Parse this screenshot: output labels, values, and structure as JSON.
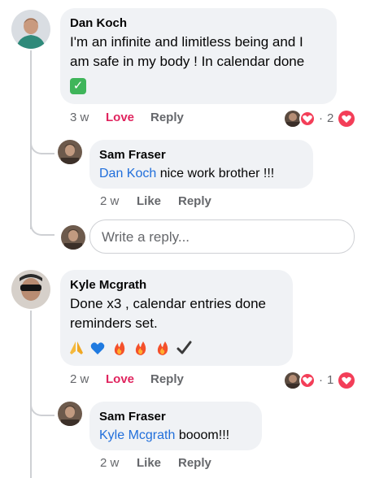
{
  "comments": [
    {
      "author": "Dan Koch",
      "text": "I'm an infinite and limitless being and I am safe in my body ! In  calendar done",
      "line1": "I'm an infinite and limitless being and I",
      "line2": "am safe in my body ! In  calendar done",
      "emoji_line": "✅",
      "time": "3 w",
      "love_label": "Love",
      "reply_label": "Reply",
      "reaction_count": "2",
      "reply": {
        "author": "Sam Fraser",
        "mention": "Dan Koch",
        "text": " nice work brother !!!",
        "time": "2 w",
        "like_label": "Like",
        "reply_label": "Reply"
      }
    },
    {
      "author": "Kyle Mcgrath",
      "line1": "Done x3 , calendar entries done",
      "line2": "reminders set.",
      "emoji_line": "🙏💙🔥🔥🔥✔️",
      "time": "2 w",
      "love_label": "Love",
      "reply_label": "Reply",
      "reaction_count": "1",
      "reply": {
        "author": "Sam Fraser",
        "mention": "Kyle Mcgrath",
        "text": " booom!!!",
        "time": "2 w",
        "like_label": "Like",
        "reply_label": "Reply"
      }
    }
  ],
  "write_reply": {
    "placeholder": "Write a reply..."
  },
  "colors": {
    "link": "#216fdb",
    "love": "#e0245e",
    "muted": "#65676b",
    "bubble": "#f0f2f5"
  }
}
